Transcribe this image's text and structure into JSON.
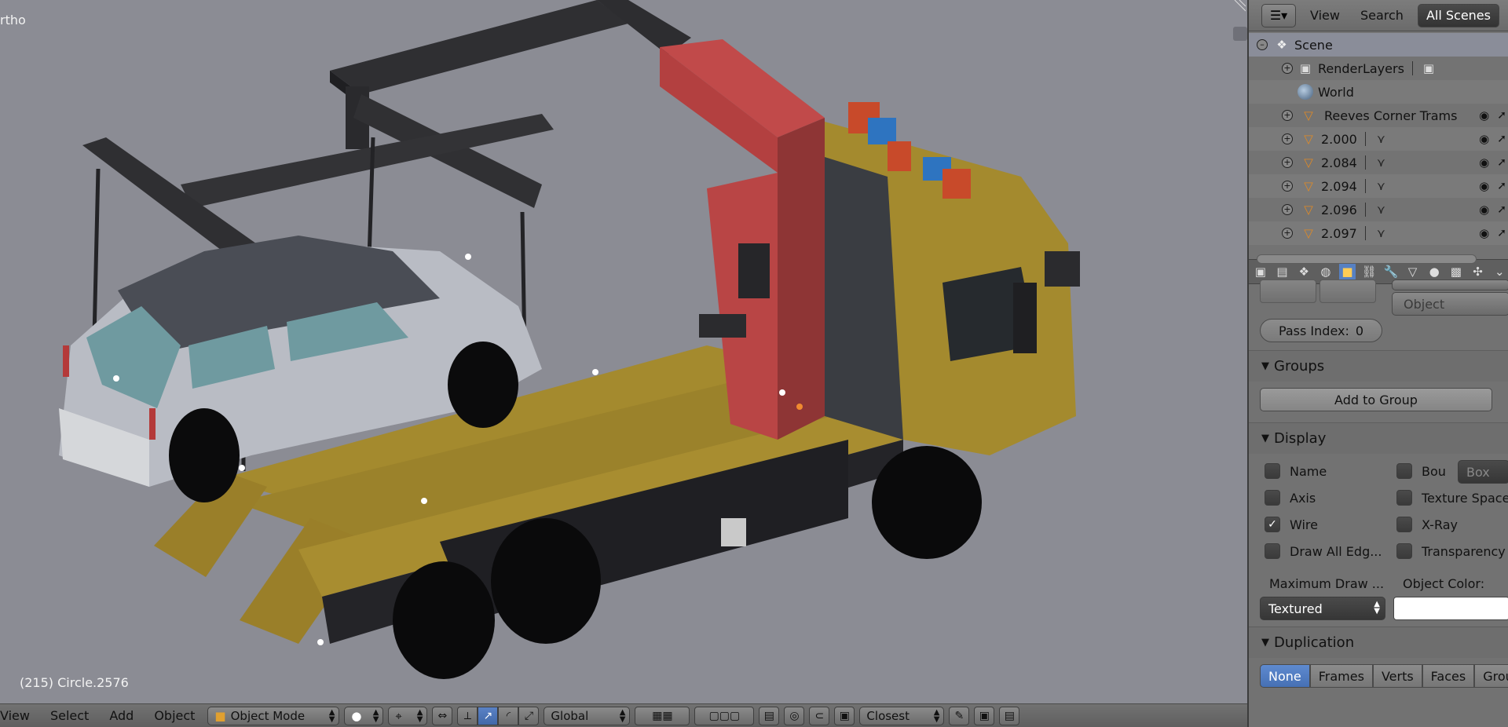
{
  "viewport": {
    "view_label": "rtho",
    "object_info": "(215) Circle.2576"
  },
  "header": {
    "menus": [
      "View",
      "Select",
      "Add",
      "Object"
    ],
    "mode": "Object Mode",
    "orientation": "Global",
    "snap": "Closest"
  },
  "outliner": {
    "header": {
      "view": "View",
      "search": "Search",
      "display": "All Scenes"
    },
    "items": [
      {
        "label": "Scene"
      },
      {
        "label": "RenderLayers"
      },
      {
        "label": "World"
      },
      {
        "label": "Reeves Corner Trams"
      },
      {
        "label": "2.000"
      },
      {
        "label": "2.084"
      },
      {
        "label": "2.094"
      },
      {
        "label": "2.096"
      },
      {
        "label": "2.097"
      }
    ]
  },
  "properties": {
    "object_dropdown": "Object",
    "pass_index_label": "Pass Index:",
    "pass_index_value": "0",
    "groups": {
      "title": "Groups",
      "add_button": "Add to Group"
    },
    "display": {
      "title": "Display",
      "checks": [
        {
          "label": "Name",
          "checked": false
        },
        {
          "label": "Bou",
          "checked": false
        },
        {
          "label": "Axis",
          "checked": false
        },
        {
          "label": "Texture Space",
          "checked": false
        },
        {
          "label": "Wire",
          "checked": true
        },
        {
          "label": "X-Ray",
          "checked": false
        },
        {
          "label": "Draw All Edg...",
          "checked": false
        },
        {
          "label": "Transparency",
          "checked": false
        }
      ],
      "bounds_type": "Box",
      "max_draw_label": "Maximum Draw ...",
      "object_color_label": "Object Color:",
      "max_draw_value": "Textured",
      "object_color": "#ffffff"
    },
    "duplication": {
      "title": "Duplication",
      "tabs": [
        "None",
        "Frames",
        "Verts",
        "Faces",
        "Group"
      ]
    }
  },
  "colors": {
    "viewport_bg": "#8b8c94",
    "truck_yellow": "#a48a2e",
    "crane_red": "#b84444",
    "car_body": "#b9bcc4",
    "rig_dark": "#353538",
    "selection_blue": "#5680c2"
  }
}
